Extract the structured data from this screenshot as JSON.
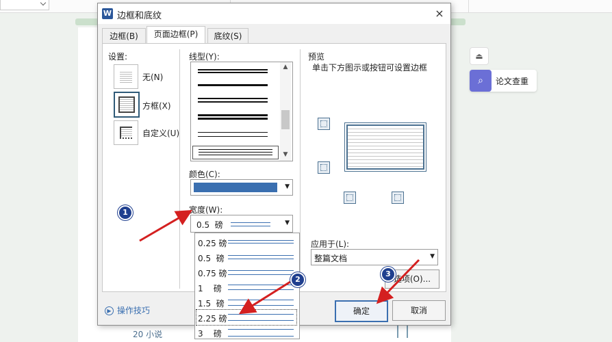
{
  "dialog": {
    "title": "边框和底纹",
    "close": "×",
    "tabs": [
      "边框(B)",
      "页面边框(P)",
      "底纹(S)"
    ]
  },
  "settings": {
    "label": "设置:",
    "items": [
      "无(N)",
      "方框(X)",
      "自定义(U)"
    ]
  },
  "line_style": {
    "label": "线型(Y):"
  },
  "color": {
    "label": "颜色(C):",
    "value": "#3a6fb0"
  },
  "width": {
    "label": "宽度(W):",
    "value": "0.5  磅",
    "options": [
      "0.25 磅",
      "0.5  磅",
      "0.75 磅",
      "1    磅",
      "1.5  磅",
      "2.25 磅",
      "3    磅"
    ]
  },
  "preview": {
    "label": "预览",
    "hint": "单击下方图示或按钮可设置边框"
  },
  "apply": {
    "label": "应用于(L):",
    "value": "整篇文档"
  },
  "options_button": "选项(O)...",
  "footer": {
    "tips": "操作技巧",
    "ok": "确定",
    "cancel": "取消"
  },
  "badges": [
    "1",
    "2",
    "3"
  ],
  "side": {
    "up": "⏏",
    "check_label": "论文查重"
  },
  "doc_text": "20 小说",
  "colors": {
    "accent": "#3a6fb0",
    "badge": "#1f3f8f",
    "arrow": "#d42020"
  }
}
